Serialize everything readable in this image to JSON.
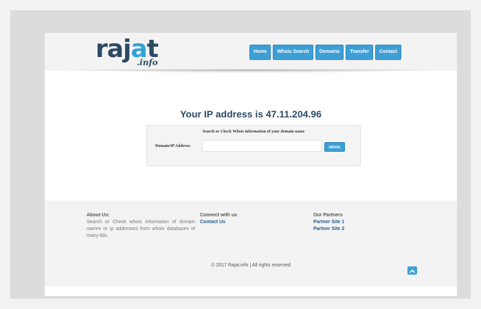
{
  "logo": {
    "main_start": "raj",
    "main_accent": "a",
    "main_end": "t",
    "sub": ".info"
  },
  "nav": {
    "home": "Home",
    "whois_search": "Whois Search",
    "domains": "Domains",
    "transfer": "Transfer",
    "contact": "Contact"
  },
  "main": {
    "ip_title": "Your IP address is 47.11.204.96",
    "search_caption": "Search or Check Whois information of your domain name",
    "search_label": "Domain/IP Address:",
    "search_value": "",
    "search_button": "whois"
  },
  "footer": {
    "about_title": "About Us:",
    "about_text": "Search or Check whois information of domain names or ip addresses from whois databases of many tlds.",
    "connect_title": "Connect with us",
    "contact_link": "Contact Us",
    "partners_title": "Our Partners",
    "partner1": "Partner Site 1",
    "partner2": "Partner Site 2",
    "copyright": "© 2017 Rajat.info | All rights reserved"
  },
  "colors": {
    "accent": "#3e9fd6",
    "dark_blue": "#2b4a63",
    "link": "#1f5a8c"
  },
  "icons": {
    "scroll_top": "chevron-up-icon"
  }
}
